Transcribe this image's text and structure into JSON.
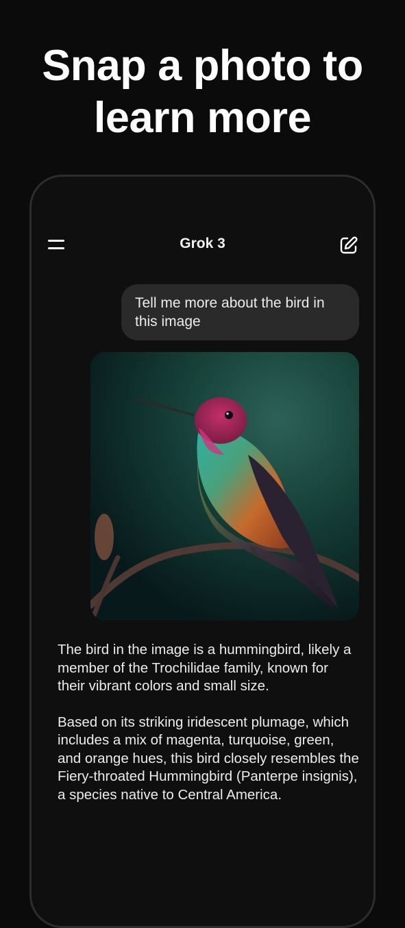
{
  "promo": {
    "headline_line1": "Snap a photo to",
    "headline_line2": "learn more"
  },
  "app": {
    "title": "Grok 3",
    "menu_icon": "hamburger-menu-icon",
    "compose_icon": "edit-compose-icon"
  },
  "chat": {
    "user_message": "Tell me more about the bird in this image",
    "image_subject": "hummingbird on a branch",
    "response_paragraphs": [
      "The bird in the image is a hummingbird, likely a member of the Trochilidae family, known for their vibrant colors and small size.",
      "Based on its striking iridescent plumage, which includes a mix of magenta, turquoise, green, and orange hues, this bird closely resembles the Fiery-throated Hummingbird (Panterpe insignis), a species native to Central America."
    ]
  },
  "colors": {
    "background": "#0b0b0b",
    "phone_frame": "#2d2d2d",
    "bubble": "#2a2a2b",
    "text": "#ececec"
  }
}
